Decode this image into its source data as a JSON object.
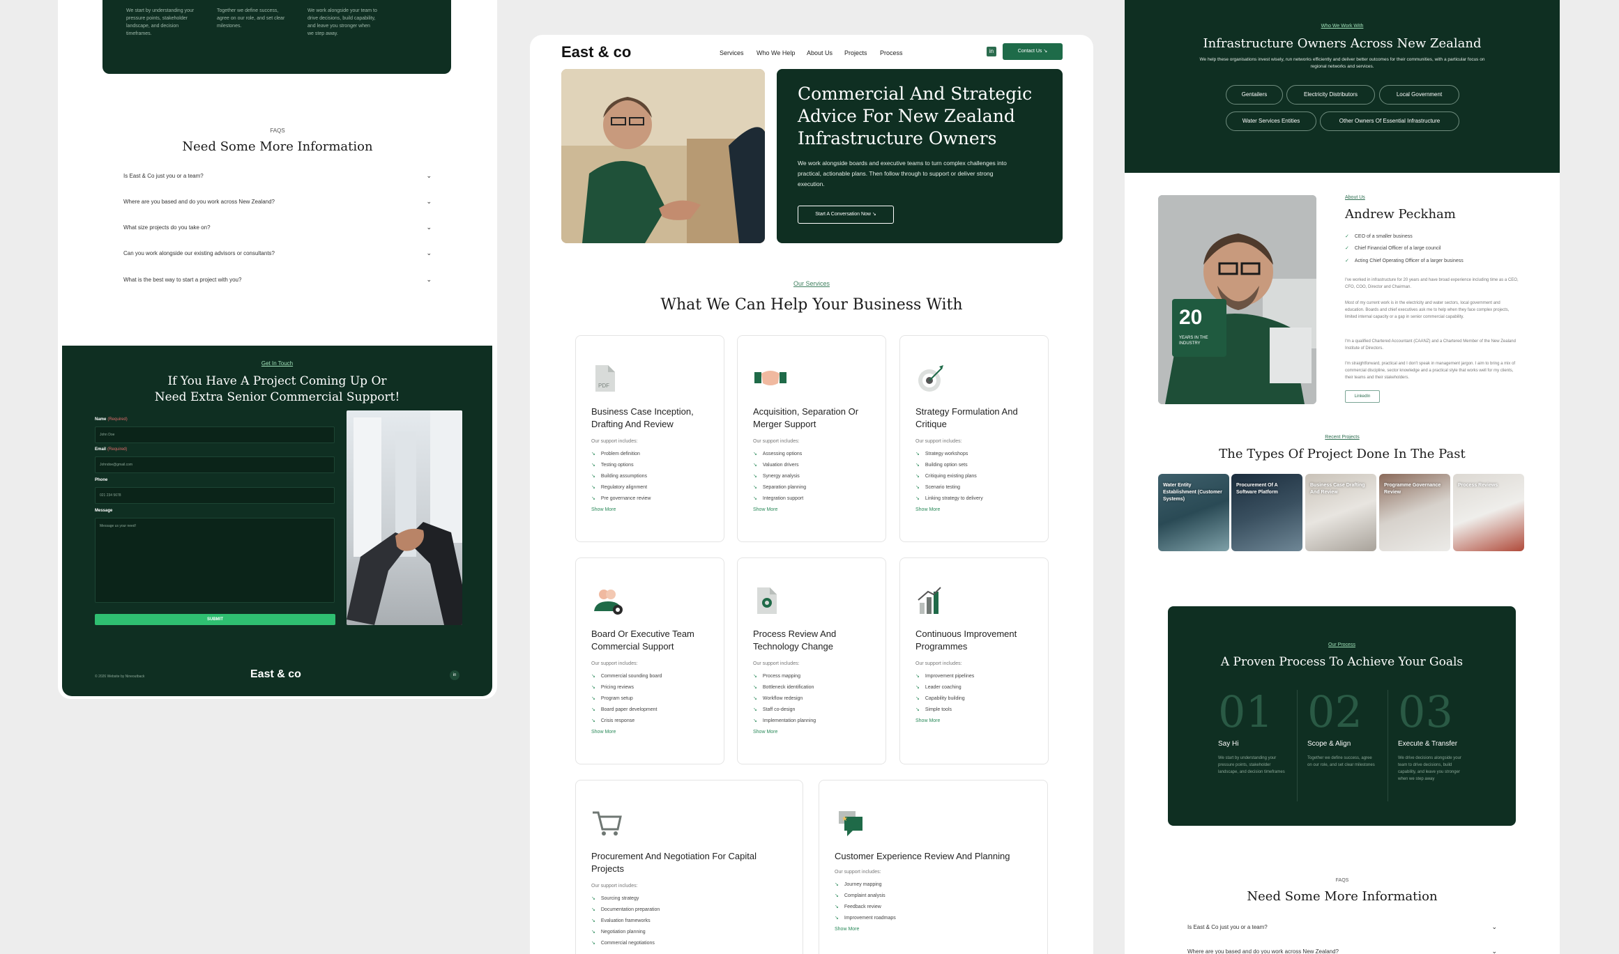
{
  "left": {
    "top_cols": [
      "We start by understanding your pressure points, stakeholder landscape, and decision timeframes.",
      "Together we define success, agree on our role, and set clear milestones.",
      "We work alongside your team to drive decisions, build capability, and leave you stronger when we step away."
    ],
    "faq_kicker": "FAQS",
    "faq_title": "Need Some More Information",
    "faqs": [
      "Is East & Co just you or a team?",
      "Where are you based and do you work across New Zealand?",
      "What size projects do you take on?",
      "Can you work alongside our existing advisors or consultants?",
      "What is the best way to start a project with you?"
    ],
    "contact": {
      "kicker": "Get In Touch",
      "title_line1": "If You Have A Project Coming Up Or",
      "title_line2": "Need Extra Senior Commercial Support!",
      "name_label": "Name",
      "email_label": "Email",
      "required": "(Required)",
      "name_placeholder": "John Doe",
      "email_placeholder": "Johndoe@gmail.com",
      "phone_label": "Phone",
      "phone_placeholder": "021 234 5678",
      "message_label": "Message",
      "message_placeholder": "Message us your need!",
      "submit": "SUBMIT",
      "copyright": "© 2026 Website by Nineoutback",
      "logo": "East & co",
      "linkedin": "in"
    }
  },
  "center": {
    "logo": "East & co",
    "nav": [
      "Services",
      "Who We Help",
      "About Us",
      "Projects",
      "Process"
    ],
    "linkedin": "in",
    "contact_button": "Contact Us ↘",
    "hero": {
      "title": "Commercial And Strategic Advice For New Zealand Infrastructure Owners",
      "desc": "We work alongside boards and executive teams to turn complex challenges into practical, actionable plans. Then follow through to support or deliver strong execution.",
      "button": "Start A Conversation Now ↘"
    },
    "services_kicker": "Our Services",
    "services_title": "What We Can Help Your Business With",
    "support_label": "Our support includes:",
    "show_more": "Show More",
    "cards": [
      {
        "title": "Business Case Inception, Drafting And Review",
        "icon": "pdf-icon",
        "items": [
          "Problem definition",
          "Testing options",
          "Building assumptions",
          "Regulatory alignment",
          "Pre governance review"
        ]
      },
      {
        "title": "Acquisition, Separation Or Merger Support",
        "icon": "handshake-icon",
        "items": [
          "Assessing options",
          "Valuation drivers",
          "Synergy analysis",
          "Separation planning",
          "Integration support"
        ]
      },
      {
        "title": "Strategy Formulation And Critique",
        "icon": "target-icon",
        "items": [
          "Strategy workshops",
          "Building option sets",
          "Critiquing existing plans",
          "Scenario testing",
          "Linking strategy to delivery"
        ]
      },
      {
        "title": "Board Or Executive Team Commercial Support",
        "icon": "team-gear-icon",
        "items": [
          "Commercial sounding board",
          "Pricing reviews",
          "Program setup",
          "Board paper development",
          "Crisis response"
        ]
      },
      {
        "title": "Process Review And Technology Change",
        "icon": "document-gear-icon",
        "items": [
          "Process mapping",
          "Bottleneck identification",
          "Workflow redesign",
          "Staff co-design",
          "Implementation planning"
        ]
      },
      {
        "title": "Continuous Improvement Programmes",
        "icon": "bar-chart-icon",
        "items": [
          "Improvement pipelines",
          "Leader coaching",
          "Capability building",
          "Simple tools"
        ]
      },
      {
        "title": "Procurement And Negotiation For Capital Projects",
        "icon": "cart-icon",
        "items": [
          "Sourcing strategy",
          "Documentation preparation",
          "Evaluation frameworks",
          "Negotiation planning",
          "Commercial negotiations"
        ]
      },
      {
        "title": "Customer Experience Review And Planning",
        "icon": "chat-star-icon",
        "items": [
          "Journey mapping",
          "Complaint analysis",
          "Feedback review",
          "Improvement roadmaps"
        ]
      }
    ]
  },
  "right": {
    "who_kicker": "Who We Work With",
    "who_title": "Infrastructure Owners Across New Zealand",
    "who_desc": "We help these organisations invest wisely, run networks efficiently and deliver better outcomes for their communities, with a particular focus on regional networks and services.",
    "pills": [
      "Gentailers",
      "Electricity Distributors",
      "Local Government",
      "Water Services Entities",
      "Other Owners Of Essential Infrastructure"
    ],
    "badge_number": "20",
    "badge_text": "YEARS IN THE INDUSTRY",
    "about_kicker": "About Us",
    "about_name": "Andrew Peckham",
    "about_list": [
      "CEO of a smaller business",
      "Chief Financial Officer of a large council",
      "Acting Chief Operating Officer of a larger business"
    ],
    "about_paras": [
      "I've worked in infrastructure for 20 years and have broad experience including time as a CEO, CFO, COO, Director and Chairman.",
      "Most of my current work is in the electricity and water sectors, local government and education. Boards and chief executives ask me to help when they face complex projects, limited internal capacity or a gap in senior commercial capability.",
      "I'm a qualified Chartered Accountant (CAANZ) and a Chartered Member of the New Zealand Institute of Directors.",
      "I'm straightforward, practical and I don't speak in management jargon. I aim to bring a mix of commercial discipline, sector knowledge and a practical style that works well for my clients, their teams and their stakeholders."
    ],
    "linkedin_button": "LinkedIn",
    "projects_kicker": "Recent Projects",
    "projects_title": "The Types Of Project Done In The Past",
    "projects": [
      "Water Entity Establishment (Customer Systems)",
      "Procurement Of A Software Platform",
      "Business Case Drafting And Review",
      "Programme Governance Review",
      "Process Reviews"
    ],
    "process_kicker": "Our Process",
    "process_title": "A Proven Process To Achieve Your Goals",
    "steps": [
      {
        "num": "01",
        "title": "Say Hi",
        "desc": "We start by understanding your pressure points, stakeholder landscape, and decision timeframes"
      },
      {
        "num": "02",
        "title": "Scope & Align",
        "desc": "Together we define success, agree on our role, and set clear milestones"
      },
      {
        "num": "03",
        "title": "Execute & Transfer",
        "desc": "We drive decisions alongside your team to drive decisions, build capability, and leave you stronger when we step away"
      }
    ],
    "faq_kicker": "FAQS",
    "faq_title": "Need Some More Information",
    "faq_first": "Is East & Co just you or a team?",
    "faq_second": "Where are you based and do you work across New Zealand?"
  }
}
